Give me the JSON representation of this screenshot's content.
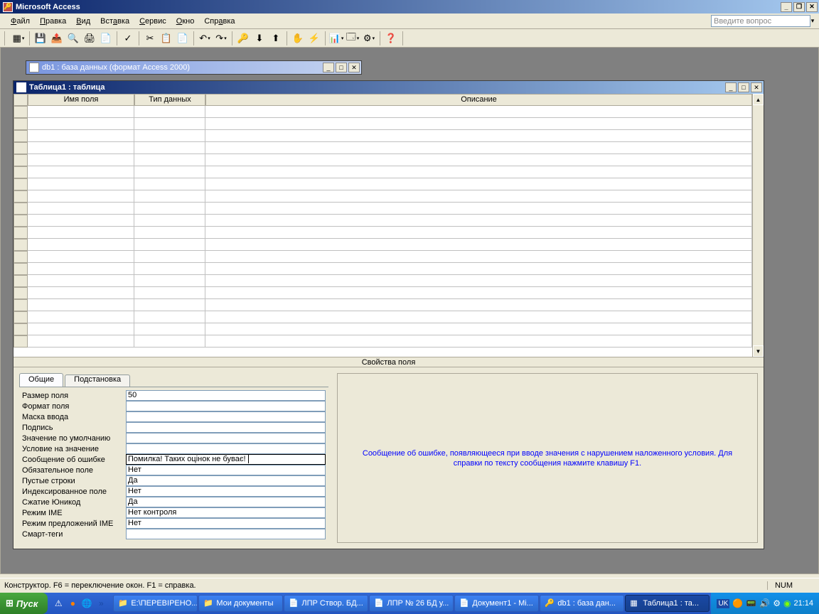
{
  "app": {
    "title": "Microsoft Access"
  },
  "menu": {
    "items": [
      "Файл",
      "Правка",
      "Вид",
      "Вставка",
      "Сервис",
      "Окно",
      "Справка"
    ],
    "ask_placeholder": "Введите вопрос"
  },
  "db_window": {
    "title": "db1 : база данных (формат Access 2000)"
  },
  "design_window": {
    "title": "Таблица1 : таблица"
  },
  "grid_headers": {
    "col1": "Имя поля",
    "col2": "Тип данных",
    "col3": "Описание"
  },
  "prop_section_label": "Свойства поля",
  "tabs": {
    "general": "Общие",
    "lookup": "Подстановка"
  },
  "properties": [
    {
      "label": "Размер поля",
      "value": "50"
    },
    {
      "label": "Формат поля",
      "value": ""
    },
    {
      "label": "Маска ввода",
      "value": ""
    },
    {
      "label": "Подпись",
      "value": ""
    },
    {
      "label": "Значение по умолчанию",
      "value": ""
    },
    {
      "label": "Условие на значение",
      "value": ""
    },
    {
      "label": "Сообщение об ошибке",
      "value": "Помилка! Таких оцінок не буває!"
    },
    {
      "label": "Обязательное поле",
      "value": "Нет"
    },
    {
      "label": "Пустые строки",
      "value": "Да"
    },
    {
      "label": "Индексированное поле",
      "value": "Нет"
    },
    {
      "label": "Сжатие Юникод",
      "value": "Да"
    },
    {
      "label": "Режим IME",
      "value": "Нет контроля"
    },
    {
      "label": "Режим предложений IME",
      "value": "Нет"
    },
    {
      "label": "Смарт-теги",
      "value": ""
    }
  ],
  "help_text": "Сообщение об ошибке, появляющееся при вводе значения с нарушением наложенного условия.  Для справки по тексту сообщения нажмите клавишу F1.",
  "statusbar": {
    "text": "Конструктор.  F6 = переключение окон.  F1 = справка.",
    "num": "NUM"
  },
  "taskbar": {
    "start": "Пуск",
    "tasks": [
      "E:\\ПЕРЕВІРЕНО...",
      "Мои документы",
      "ЛПР Створ. БД...",
      "ЛПР № 26 БД у...",
      "Документ1 - Mi...",
      "db1 : база дан...",
      "Таблица1 : та..."
    ],
    "tray_lang": "UK",
    "clock": "21:14"
  }
}
